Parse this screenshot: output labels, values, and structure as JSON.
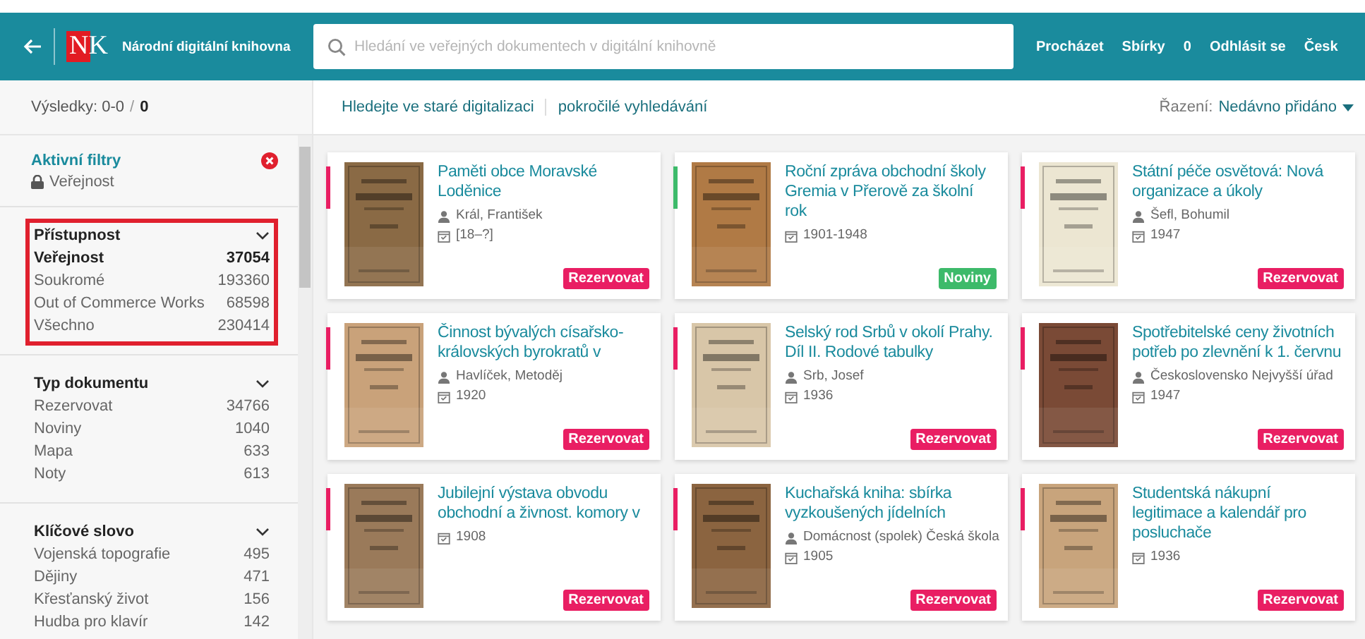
{
  "header": {
    "logo": "NK",
    "title": "Národní digitální knihovna",
    "search": {
      "placeholder": "Hledání ve veřejných dokumentech v digitální knihovně"
    },
    "nav": [
      "Procházet",
      "Sbírky",
      "0",
      "Odhlásit se",
      "Česk"
    ]
  },
  "toolbar": {
    "results_label": "Výsledky: 0-0",
    "results_separator": "/",
    "results_total": "0",
    "links": [
      "Hledejte ve staré digitalizaci",
      "pokročilé vyhledávání"
    ],
    "sort_label": "Řazení:",
    "sort_value": "Nedávno přidáno"
  },
  "active_filters": {
    "title": "Aktivní filtry",
    "items": [
      "Veřejnost"
    ]
  },
  "filter_sections": [
    {
      "title": "Přístupnost",
      "highlighted": true,
      "items": [
        {
          "label": "Veřejnost",
          "count": "37054",
          "selected": true
        },
        {
          "label": "Soukromé",
          "count": "193360",
          "selected": false
        },
        {
          "label": "Out of Commerce Works",
          "count": "68598",
          "selected": false
        },
        {
          "label": "Všechno",
          "count": "230414",
          "selected": false
        }
      ]
    },
    {
      "title": "Typ dokumentu",
      "highlighted": false,
      "items": [
        {
          "label": "Rezervovat",
          "count": "34766",
          "selected": false
        },
        {
          "label": "Noviny",
          "count": "1040",
          "selected": false
        },
        {
          "label": "Mapa",
          "count": "633",
          "selected": false
        },
        {
          "label": "Noty",
          "count": "613",
          "selected": false
        }
      ]
    },
    {
      "title": "Klíčové slovo",
      "highlighted": false,
      "items": [
        {
          "label": "Vojenská topografie",
          "count": "495",
          "selected": false
        },
        {
          "label": "Dějiny",
          "count": "471",
          "selected": false
        },
        {
          "label": "Křesťanský život",
          "count": "156",
          "selected": false
        },
        {
          "label": "Hudba pro klavír",
          "count": "142",
          "selected": false
        }
      ]
    }
  ],
  "documents": [
    {
      "title": "Paměti obce Moravské Loděnice",
      "author": "Král, František",
      "date": "[18–?]",
      "badge": "Rezervovat",
      "color": "#e91e63"
    },
    {
      "title": "Roční zpráva obchodní školy Gremia v Přerově za školní rok",
      "date": "1901-1948",
      "badge": "Noviny",
      "color": "#3dba6a"
    },
    {
      "title": "Státní péče osvětová: Nová organizace a úkoly",
      "author": "Šefl, Bohumil",
      "date": "1947",
      "badge": "Rezervovat",
      "color": "#e91e63"
    },
    {
      "title": "Činnost bývalých císařsko-královských byrokratů v",
      "author": "Havlíček, Metoděj",
      "date": "1920",
      "badge": "Rezervovat",
      "color": "#e91e63"
    },
    {
      "title": "Selský rod Srbů v okolí Prahy. Díl II. Rodové tabulky",
      "author": "Srb, Josef",
      "date": "1936",
      "badge": "Rezervovat",
      "color": "#e91e63"
    },
    {
      "title": "Spotřebitelské ceny životních potřeb po zlevnění k 1. červnu",
      "author": "Československo Nejvyšší úřad",
      "date": "1947",
      "badge": "Rezervovat",
      "color": "#e91e63"
    },
    {
      "title": "Jubilejní výstava obvodu obchodní a živnost. komory v",
      "date": "1908",
      "badge": "Rezervovat",
      "color": "#e91e63"
    },
    {
      "title": "Kuchařská kniha: sbírka vyzkoušených jídelních",
      "author": "Domácnost (spolek) Česká škola",
      "date": "1905",
      "badge": "Rezervovat",
      "color": "#e91e63"
    },
    {
      "title": "Studentská nákupní legitimace a kalendář pro posluchače",
      "date": "1936",
      "badge": "Rezervovat",
      "color": "#e91e63"
    }
  ]
}
